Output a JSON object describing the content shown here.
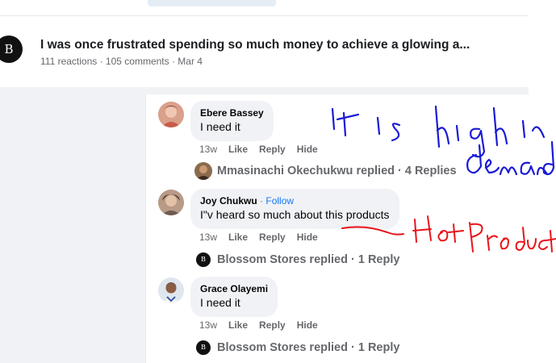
{
  "post": {
    "logo_text": "B",
    "title": "I was once frustrated spending so much money to achieve a glowing a...",
    "meta": "111 reactions · 105 comments · Mar 4"
  },
  "comments": [
    {
      "name": "Ebere Bassey",
      "follow": "",
      "text": "I need it",
      "time": "13w",
      "like": "Like",
      "reply": "Reply",
      "hide": "Hide",
      "replies_text": "Mmasinachi Okechukwu replied · 4 Replies"
    },
    {
      "name": "Joy Chukwu",
      "separator": "·",
      "follow": "Follow",
      "text": "I\"v heard so much about this products",
      "time": "13w",
      "like": "Like",
      "reply": "Reply",
      "hide": "Hide",
      "replies_text": "Blossom Stores replied · 1 Reply"
    },
    {
      "name": "Grace Olayemi",
      "follow": "",
      "text": "I need it",
      "time": "13w",
      "like": "Like",
      "reply": "Reply",
      "hide": "Hide",
      "replies_text": "Blossom Stores replied · 1 Reply"
    }
  ],
  "reply_logo_text": "B",
  "annotations": {
    "blue_text": "It is high in demand",
    "red_text": "Hot Product",
    "blue_color": "#1a1ad6",
    "red_color": "#e8141a"
  }
}
